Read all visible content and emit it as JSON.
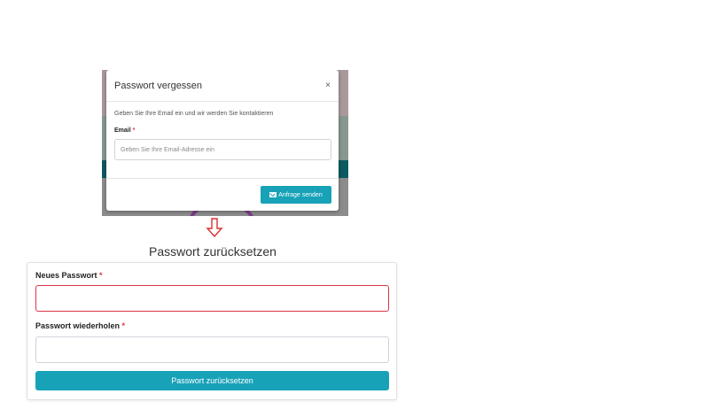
{
  "modal": {
    "title": "Passwort vergessen",
    "close_symbol": "×",
    "description": "Geben Sie Ihre Email ein und wir werden Sie kontaktieren",
    "email_label": "Email",
    "required_mark": "*",
    "email_placeholder": "Geben Sie Ihre Email-Adresse ein",
    "send_button_label": "Anfrage senden",
    "send_button_icon": "envelope-icon"
  },
  "arrow_icon": "down-arrow-icon",
  "reset": {
    "heading": "Passwort zurücksetzen",
    "new_password_label": "Neues Passwort",
    "repeat_password_label": "Passwort wiederholen",
    "required_mark": "*",
    "submit_label": "Passwort zurücksetzen"
  },
  "colors": {
    "accent": "#17a2b8",
    "error": "#dc3545"
  }
}
